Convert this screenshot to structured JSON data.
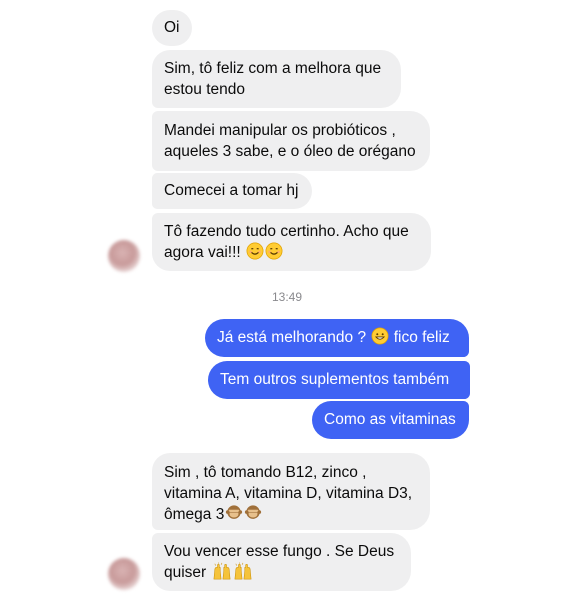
{
  "messages_in_1": [
    "Oi",
    "Sim, tô feliz com a melhora que estou tendo",
    "Mandei manipular os probióticos , aqueles 3 sabe, e o óleo de orégano",
    "Comecei a tomar hj",
    "Tô fazendo tudo certinho. Acho que agora vai!!!"
  ],
  "timestamp": "13:49",
  "messages_out": [
    "Já está melhorando ?",
    "fico feliz",
    "Tem outros suplementos também",
    "Como as vitaminas"
  ],
  "messages_in_2": [
    "Sim , tô tomando B12, zinco , vitamina A, vitamina D, vitamina D3, ômega 3",
    "Vou vencer esse fungo . Se Deus quiser"
  ],
  "colors": {
    "incoming_bubble": "#efeff0",
    "outgoing_bubble": "#3f63f4",
    "timestamp": "#8a8a8e"
  },
  "icons": [
    "smiling-face-emoji",
    "grinning-face-emoji",
    "see-no-evil-monkey-emoji",
    "raising-hands-emoji"
  ]
}
